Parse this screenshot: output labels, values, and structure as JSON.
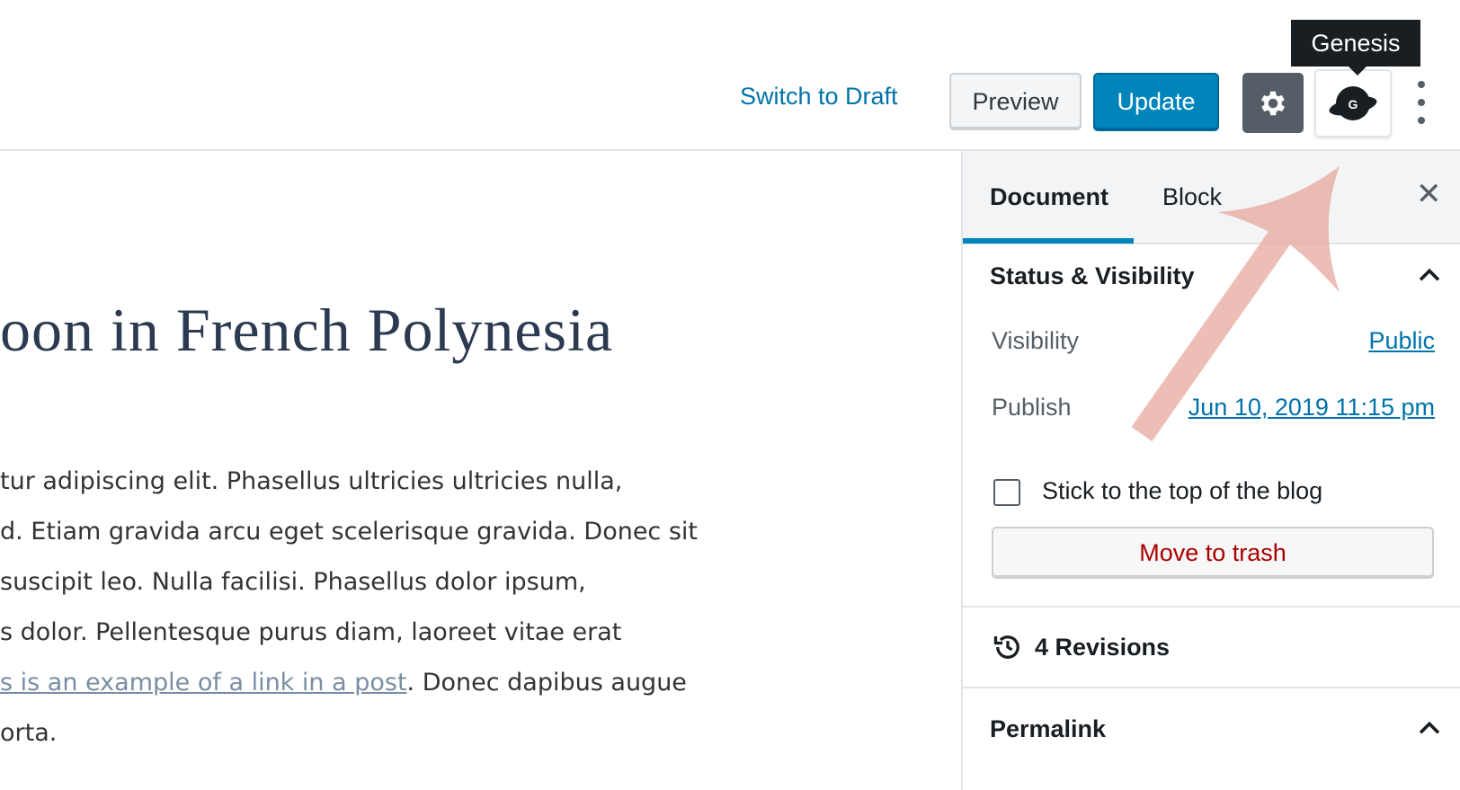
{
  "toolbar": {
    "switch_to_draft": "Switch to Draft",
    "preview": "Preview",
    "update": "Update",
    "settings_icon": "gear-icon",
    "genesis_icon": "genesis-planet-icon",
    "genesis_letter": "G",
    "more_icon": "vertical-ellipsis-icon",
    "tooltip": "Genesis"
  },
  "editor": {
    "title": "oon in French Polynesia",
    "lines": [
      "tur adipiscing elit. Phasellus ultricies ultricies nulla,",
      "d. Etiam gravida arcu eget scelerisque gravida. Donec sit",
      "suscipit leo. Nulla facilisi. Phasellus dolor ipsum,",
      "s dolor. Pellentesque purus diam, laoreet vitae erat"
    ],
    "link_text": "s is an example of a link in a post",
    "after_link": ". Donec dapibus augue",
    "last_line": "orta."
  },
  "sidebar": {
    "tabs": {
      "document": "Document",
      "block": "Block"
    },
    "close_icon": "close-icon",
    "status_panel": {
      "title": "Status & Visibility",
      "visibility_label": "Visibility",
      "visibility_value": "Public",
      "publish_label": "Publish",
      "publish_value": "Jun 10, 2019 11:15 pm",
      "sticky_label": "Stick to the top of the blog",
      "sticky_checked": false,
      "trash_label": "Move to trash"
    },
    "revisions": {
      "label": "4 Revisions",
      "icon": "history-icon"
    },
    "permalink": {
      "title": "Permalink"
    }
  },
  "colors": {
    "accent": "#0085ba",
    "link": "#0073aa",
    "danger": "#a00",
    "arrow": "#eebdb5"
  }
}
